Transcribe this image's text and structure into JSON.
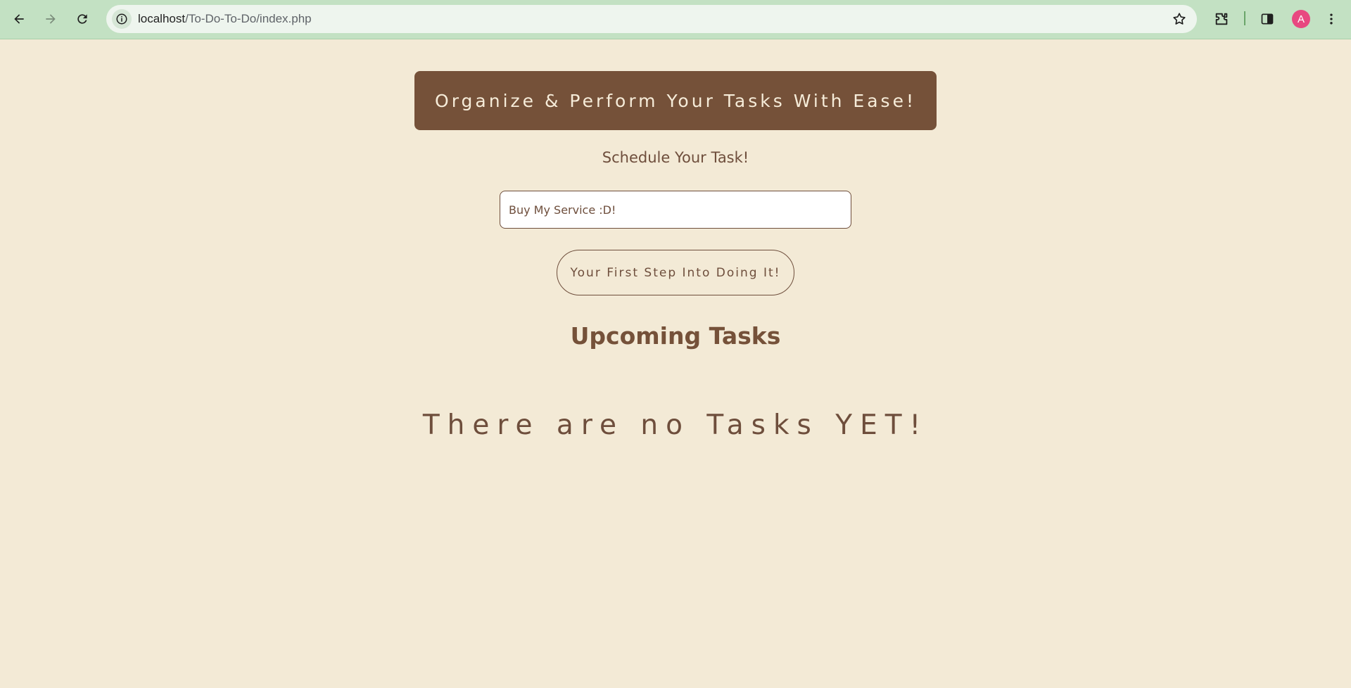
{
  "browser": {
    "url_host": "localhost",
    "url_path": "/To-Do-To-Do/index.php",
    "profile_initial": "A"
  },
  "colors": {
    "page_bg": "#f3ead6",
    "brand_brown": "#755139",
    "text_brown": "#6e4e3c",
    "chrome_green": "#c3e1c3",
    "avatar_pink": "#e84880"
  },
  "icons": [
    "back-arrow-icon",
    "forward-arrow-icon",
    "reload-icon",
    "info-icon",
    "star-icon",
    "extensions-icon",
    "side-panel-icon",
    "menu-dots-icon"
  ],
  "page": {
    "banner": "Organize & Perform Your Tasks With Ease!",
    "subtitle": "Schedule Your Task!",
    "task_input_value": "Buy My Service :D!",
    "submit_label": "Your First Step Into Doing It!",
    "section_title": "Upcoming Tasks",
    "empty_message": "There are no Tasks YET!"
  }
}
